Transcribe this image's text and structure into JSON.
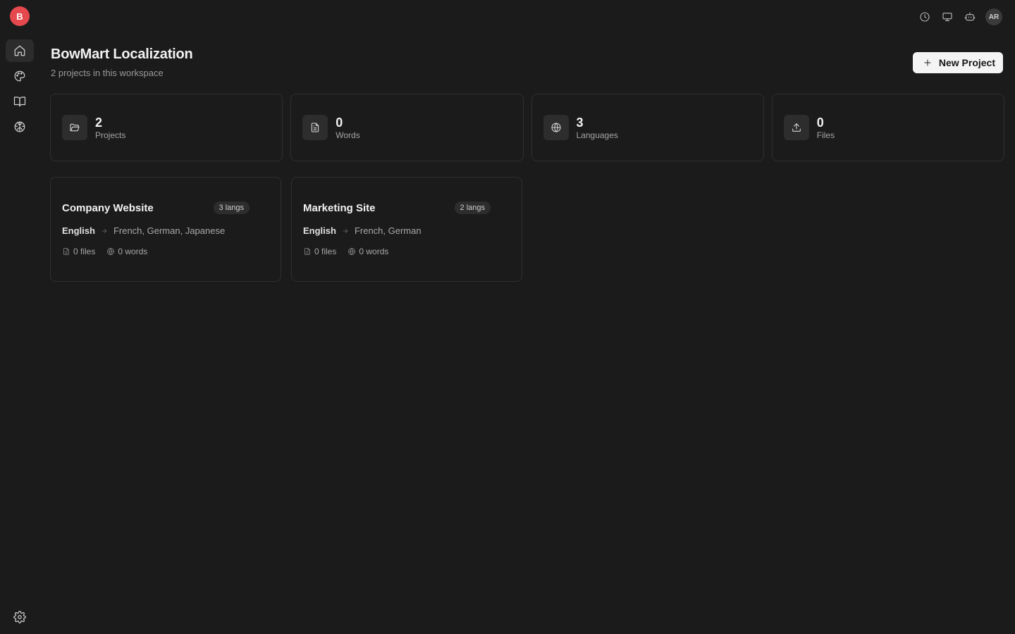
{
  "app": {
    "logo_letter": "B",
    "user_initials": "AR"
  },
  "sidebar": {
    "items": [
      {
        "name": "home",
        "icon": "home-icon",
        "active": true
      },
      {
        "name": "palette",
        "icon": "palette-icon",
        "active": false
      },
      {
        "name": "glossary",
        "icon": "book-open-icon",
        "active": false
      },
      {
        "name": "brain",
        "icon": "brain-icon",
        "active": false
      }
    ],
    "bottom": {
      "name": "settings",
      "icon": "gear-icon"
    }
  },
  "topbar": {
    "icons": [
      "clock-icon",
      "monitor-icon",
      "bot-icon"
    ]
  },
  "header": {
    "title": "BowMart Localization",
    "subtitle": "2 projects in this workspace",
    "new_project_label": "New Project"
  },
  "stats": [
    {
      "icon": "folder-open-icon",
      "value": "2",
      "label": "Projects"
    },
    {
      "icon": "file-text-icon",
      "value": "0",
      "label": "Words"
    },
    {
      "icon": "globe-icon",
      "value": "3",
      "label": "Languages"
    },
    {
      "icon": "upload-icon",
      "value": "0",
      "label": "Files"
    }
  ],
  "projects": [
    {
      "name": "Company Website",
      "badge": "3 langs",
      "source_lang": "English",
      "target_langs": "French, German, Japanese",
      "files": "0 files",
      "words": "0 words"
    },
    {
      "name": "Marketing Site",
      "badge": "2 langs",
      "source_lang": "English",
      "target_langs": "French, German",
      "files": "0 files",
      "words": "0 words"
    }
  ]
}
